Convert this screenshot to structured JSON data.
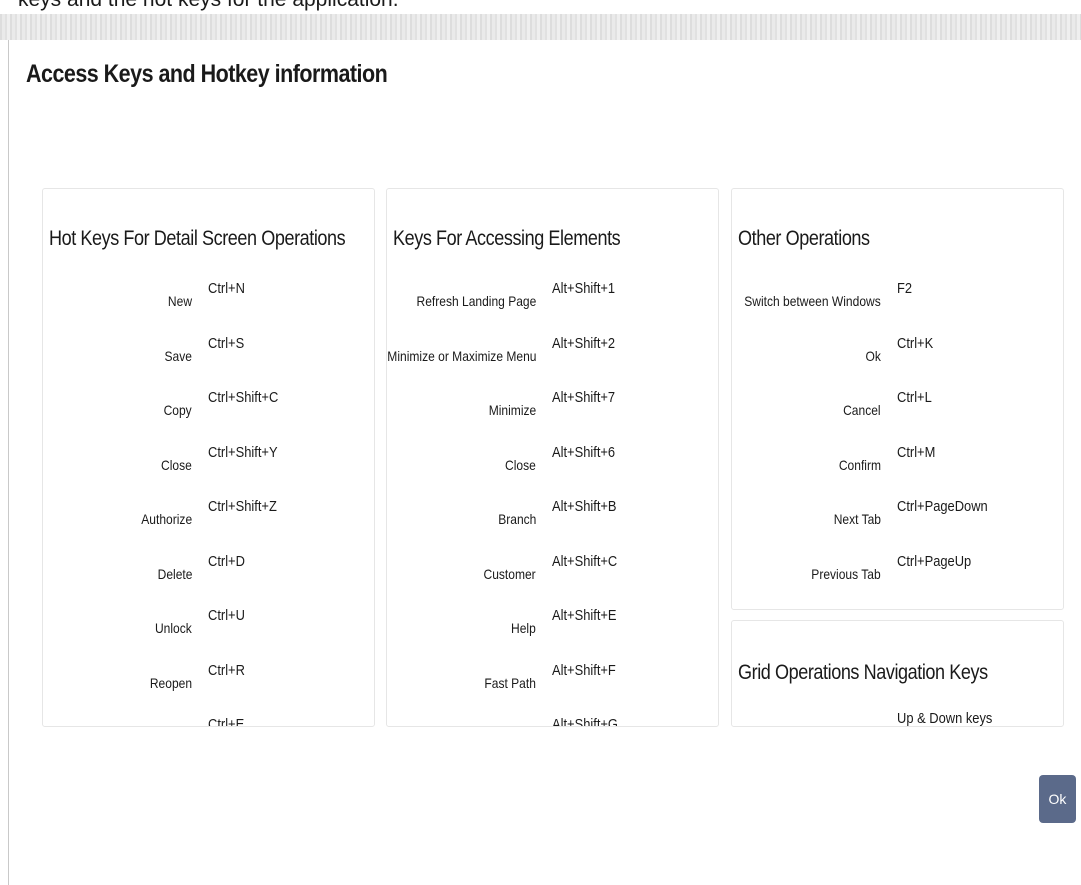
{
  "caption": "keys and the hot keys for the application.",
  "dialog": {
    "title": "Access Keys and Hotkey information",
    "ok_label": "Ok"
  },
  "panels": {
    "detail": {
      "title": "Hot Keys For Detail Screen Operations",
      "rows": [
        {
          "label": "New",
          "key": "Ctrl+N"
        },
        {
          "label": "Save",
          "key": "Ctrl+S"
        },
        {
          "label": "Copy",
          "key": "Ctrl+Shift+C"
        },
        {
          "label": "Close",
          "key": "Ctrl+Shift+Y"
        },
        {
          "label": "Authorize",
          "key": "Ctrl+Shift+Z"
        },
        {
          "label": "Delete",
          "key": "Ctrl+D"
        },
        {
          "label": "Unlock",
          "key": "Ctrl+U"
        },
        {
          "label": "Reopen",
          "key": "Ctrl+R"
        },
        {
          "label": "",
          "key": "Ctrl+E"
        }
      ]
    },
    "elements": {
      "title": "Keys For Accessing Elements",
      "rows": [
        {
          "label": "Refresh Landing Page",
          "key": "Alt+Shift+1"
        },
        {
          "label": "Minimize or Maximize Menu",
          "key": "Alt+Shift+2"
        },
        {
          "label": "Minimize",
          "key": "Alt+Shift+7"
        },
        {
          "label": "Close",
          "key": "Alt+Shift+6"
        },
        {
          "label": "Branch",
          "key": "Alt+Shift+B"
        },
        {
          "label": "Customer",
          "key": "Alt+Shift+C"
        },
        {
          "label": "Help",
          "key": "Alt+Shift+E"
        },
        {
          "label": "Fast Path",
          "key": "Alt+Shift+F"
        },
        {
          "label": "..",
          "key": "Alt+Shift+G"
        }
      ]
    },
    "other": {
      "title": "Other Operations",
      "rows": [
        {
          "label": "Switch between Windows",
          "key": "F2"
        },
        {
          "label": "Ok",
          "key": "Ctrl+K"
        },
        {
          "label": "Cancel",
          "key": "Ctrl+L"
        },
        {
          "label": "Confirm",
          "key": "Ctrl+M"
        },
        {
          "label": "Next Tab",
          "key": "Ctrl+PageDown"
        },
        {
          "label": "Previous Tab",
          "key": "Ctrl+PageUp"
        }
      ]
    },
    "grid": {
      "title": "Grid Operations Navigation Keys",
      "rows": [
        {
          "label": "",
          "key": "Up & Down keys"
        }
      ]
    }
  }
}
